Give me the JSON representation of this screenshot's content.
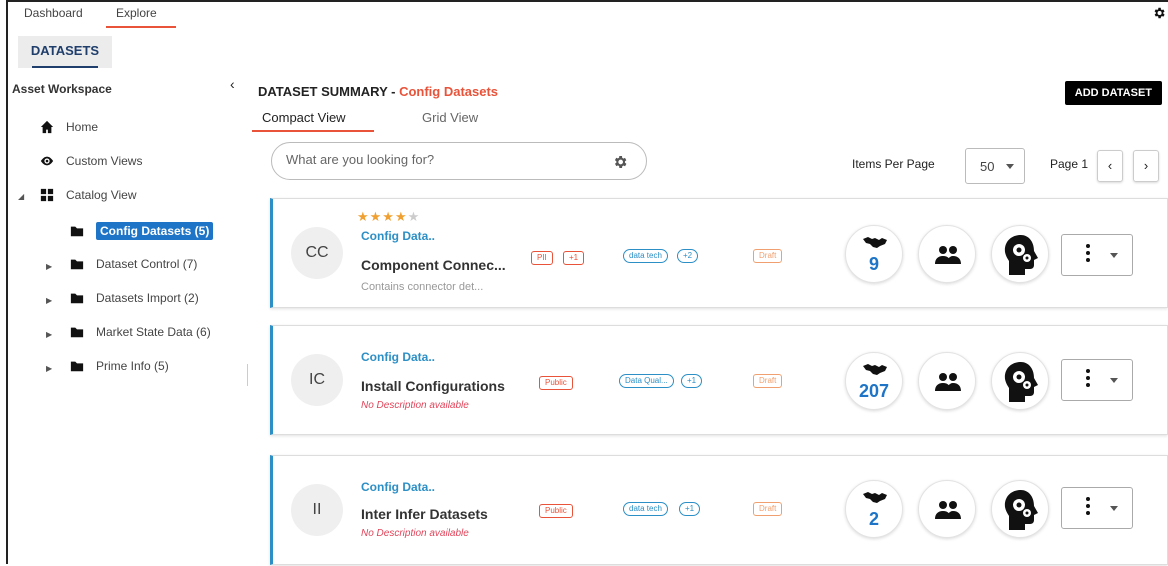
{
  "topnav": {
    "tabs": [
      "Dashboard",
      "Explore"
    ],
    "active": "Explore"
  },
  "datasets_tab": "DATASETS",
  "sidebar": {
    "title": "Asset Workspace",
    "items": [
      {
        "label": "Home",
        "icon": "home-icon"
      },
      {
        "label": "Custom Views",
        "icon": "eye-icon"
      },
      {
        "label": "Catalog View",
        "icon": "grid-icon"
      }
    ],
    "folders": [
      {
        "label": "Config Datasets (5)",
        "selected": true
      },
      {
        "label": "Dataset Control (7)"
      },
      {
        "label": "Datasets Import (2)"
      },
      {
        "label": "Market State Data (6)"
      },
      {
        "label": "Prime Info (5)"
      }
    ]
  },
  "main": {
    "summary_prefix": "DATASET SUMMARY - ",
    "summary_name": "Config Datasets",
    "add_button": "ADD DATASET",
    "view_tabs": [
      "Compact View",
      "Grid View"
    ],
    "search_placeholder": "What are you looking for?",
    "items_per_page_label": "Items Per Page",
    "items_per_page": "50",
    "page_label": "Page 1",
    "prev": "‹",
    "next": "›"
  },
  "cards": [
    {
      "initials": "CC",
      "rating": 4,
      "crumb": "Config Data..",
      "title": "Component Connec...",
      "description": "Contains connector det...",
      "tags_red": [
        "PII",
        "+1"
      ],
      "tags_blue": [
        "data tech",
        "+2"
      ],
      "status": "Draft",
      "endorse_count": "9"
    },
    {
      "initials": "IC",
      "crumb": "Config Data..",
      "title": "Install Configurations",
      "description": "No Description available",
      "tags_red": [
        "Public"
      ],
      "tags_blue": [
        "Data Qual...",
        "+1"
      ],
      "status": "Draft",
      "endorse_count": "207"
    },
    {
      "initials": "II",
      "crumb": "Config Data..",
      "title": "Inter Infer Datasets",
      "description": "No Description available",
      "tags_red": [
        "Public"
      ],
      "tags_blue": [
        "data tech",
        "+1"
      ],
      "status": "Draft",
      "endorse_count": "2"
    }
  ],
  "colors": {
    "accent": "#e8533a",
    "blue": "#2c8fc6",
    "selected": "#1e74c7"
  }
}
